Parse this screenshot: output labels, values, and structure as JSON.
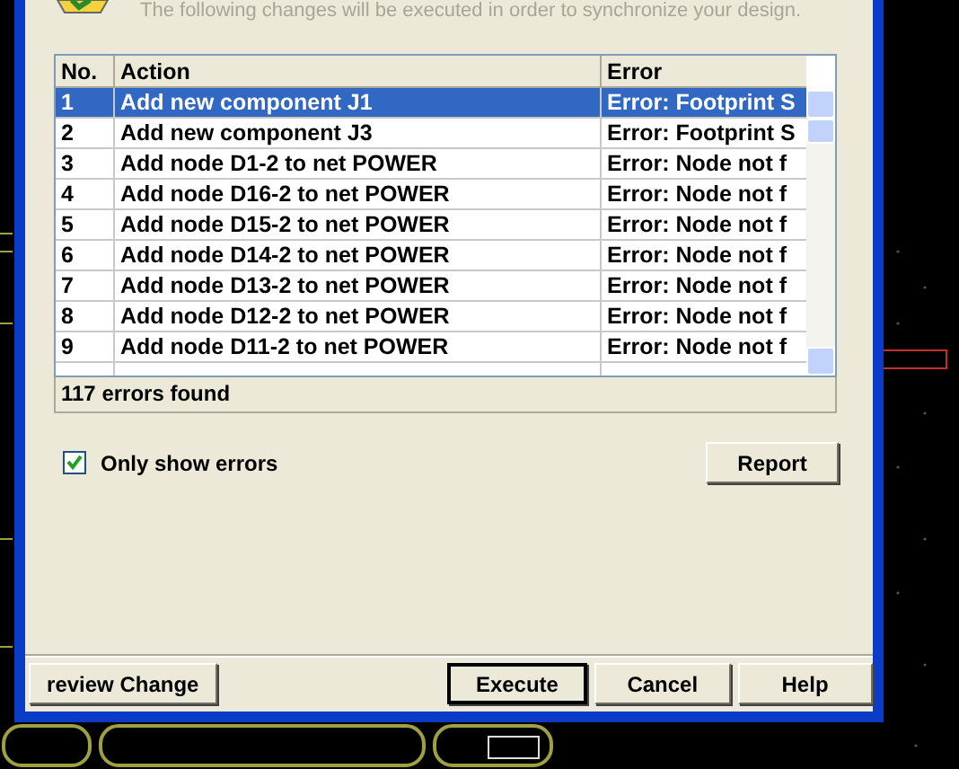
{
  "header": {
    "message": "The following changes will be executed in order to synchronize your design."
  },
  "table": {
    "columns": [
      "No.",
      "Action",
      "Error"
    ],
    "rows": [
      {
        "no": "1",
        "action": "Add new component J1",
        "error": "Error: Footprint S",
        "selected": true
      },
      {
        "no": "2",
        "action": "Add new component J3",
        "error": "Error: Footprint S",
        "selected": false
      },
      {
        "no": "3",
        "action": "Add node D1-2 to net POWER",
        "error": "Error: Node not f",
        "selected": false
      },
      {
        "no": "4",
        "action": "Add node D16-2 to net POWER",
        "error": "Error: Node not f",
        "selected": false
      },
      {
        "no": "5",
        "action": "Add node D15-2 to net POWER",
        "error": "Error: Node not f",
        "selected": false
      },
      {
        "no": "6",
        "action": "Add node D14-2 to net POWER",
        "error": "Error: Node not f",
        "selected": false
      },
      {
        "no": "7",
        "action": "Add node D13-2 to net POWER",
        "error": "Error: Node not f",
        "selected": false
      },
      {
        "no": "8",
        "action": "Add node D12-2 to net POWER",
        "error": "Error: Node not f",
        "selected": false
      },
      {
        "no": "9",
        "action": "Add node D11-2 to net POWER",
        "error": "Error: Node not f",
        "selected": false
      }
    ]
  },
  "status": "117 errors found",
  "only_show_errors": {
    "label": "Only show errors",
    "checked": true
  },
  "report_button": "Report",
  "buttons": [
    {
      "label": "review Change",
      "default": false
    },
    {
      "label": "Execute",
      "default": true
    },
    {
      "label": "Cancel",
      "default": false
    },
    {
      "label": "Help",
      "default": false
    }
  ]
}
